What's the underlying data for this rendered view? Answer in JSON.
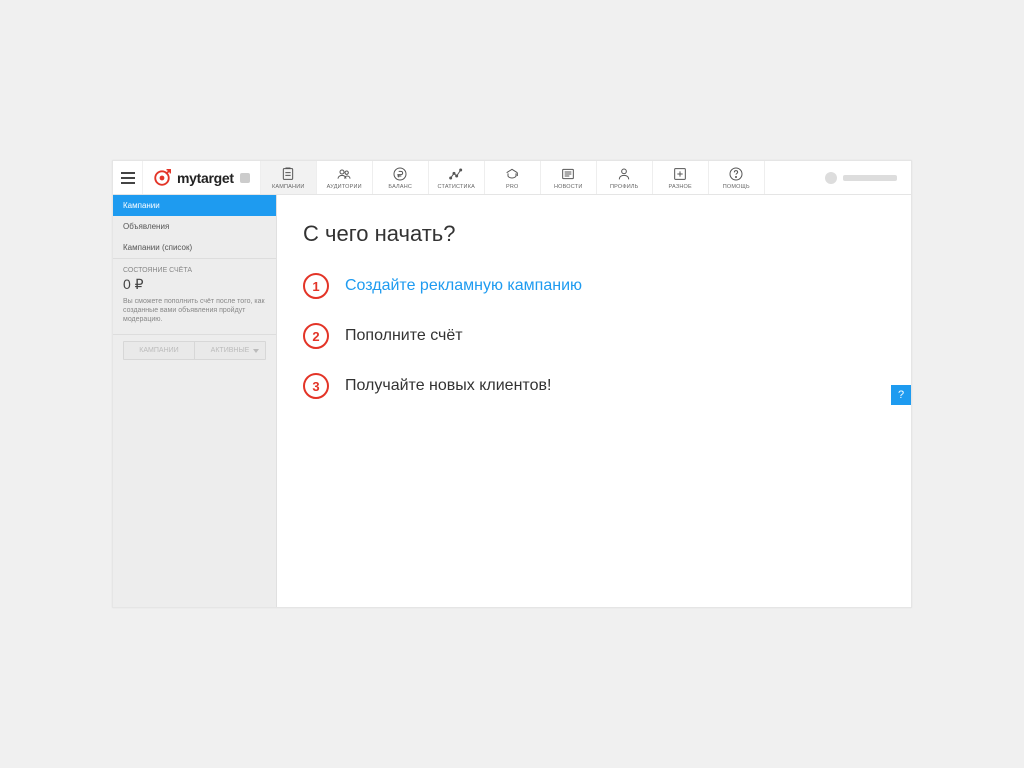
{
  "logo": {
    "text": "mytarget"
  },
  "nav": {
    "items": [
      {
        "label": "КАМПАНИИ",
        "icon": "campaigns-icon",
        "active": true
      },
      {
        "label": "АУДИТОРИИ",
        "icon": "audiences-icon"
      },
      {
        "label": "БАЛАНС",
        "icon": "balance-icon"
      },
      {
        "label": "СТАТИСТИКА",
        "icon": "stats-icon"
      },
      {
        "label": "PRO",
        "icon": "pro-icon"
      },
      {
        "label": "НОВОСТИ",
        "icon": "news-icon"
      },
      {
        "label": "ПРОФИЛЬ",
        "icon": "profile-icon"
      },
      {
        "label": "РАЗНОЕ",
        "icon": "misc-icon"
      },
      {
        "label": "ПОМОЩЬ",
        "icon": "help-icon"
      }
    ]
  },
  "sidebar": {
    "items": [
      {
        "label": "Кампании",
        "active": true
      },
      {
        "label": "Объявления"
      },
      {
        "label": "Кампании (список)"
      }
    ],
    "balance": {
      "title": "СОСТОЯНИЕ СЧЁТА",
      "value": "0 ₽",
      "note": "Вы сможете пополнить счёт после того, как созданные вами объявления пройдут модерацию."
    },
    "filter": {
      "left": "КАМПАНИИ",
      "right": "АКТИВНЫЕ"
    }
  },
  "main": {
    "title": "С чего начать?",
    "steps": [
      {
        "n": "1",
        "text": "Создайте рекламную кампанию",
        "link": true
      },
      {
        "n": "2",
        "text": "Пополните счёт"
      },
      {
        "n": "3",
        "text": "Получайте новых клиентов!"
      }
    ]
  },
  "help_button": "?"
}
